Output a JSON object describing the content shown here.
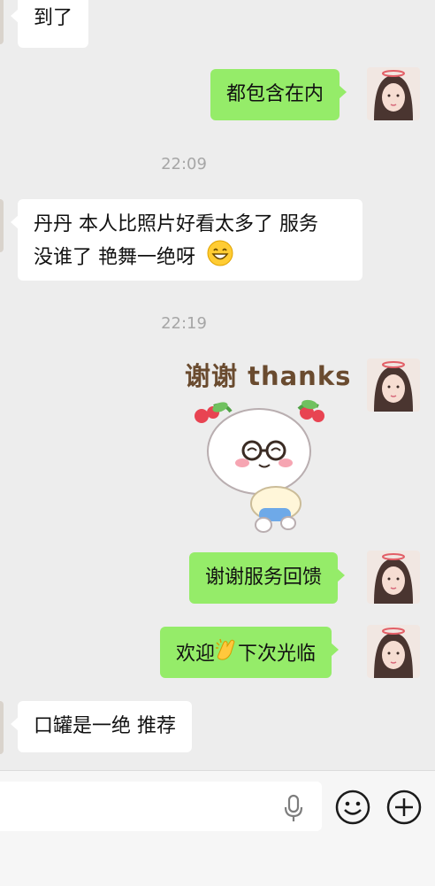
{
  "messages": [
    {
      "side": "in",
      "text": "到了"
    },
    {
      "side": "out",
      "text": "都包含在内"
    },
    {
      "type": "time",
      "text": "22:09"
    },
    {
      "side": "in",
      "line1": "丹丹 本人比照片好看太多了 服务",
      "line2": "没谁了 艳舞一绝呀",
      "emoji": "grin-emoji"
    },
    {
      "type": "time",
      "text": "22:19"
    },
    {
      "side": "out",
      "type": "sticker",
      "caption": "谢谢 thanks"
    },
    {
      "side": "out",
      "text": "谢谢服务回馈"
    },
    {
      "side": "out",
      "pre": "欢迎",
      "emoji": "clapping-hands-emoji",
      "post": "下次光临"
    },
    {
      "side": "in",
      "text": "口罐是一绝 推荐"
    }
  ],
  "colors": {
    "background": "#ededed",
    "outgoing_bubble": "#95ec69",
    "incoming_bubble": "#ffffff",
    "timestamp": "#a6a6a6"
  },
  "input_bar": {
    "voice_icon": "microphone-icon",
    "emoji_icon": "smiley-face-icon",
    "more_icon": "plus-circle-icon"
  }
}
